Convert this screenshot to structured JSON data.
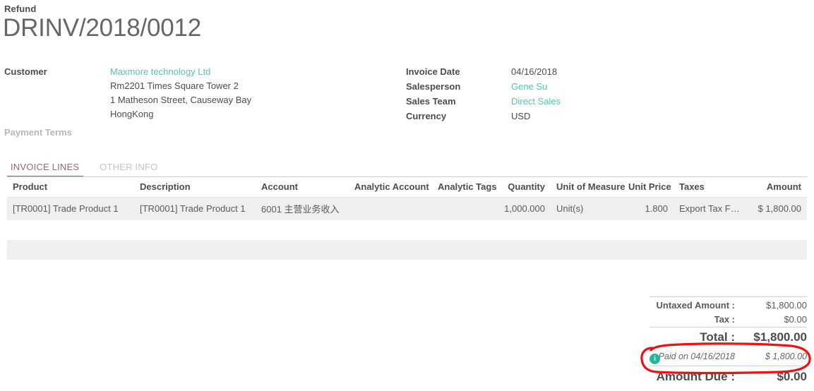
{
  "header": {
    "doc_type": "Refund",
    "title": "DRINV/2018/0012"
  },
  "fields_left": {
    "customer_label": "Customer",
    "customer_name": "Maxmore technology Ltd",
    "address_line1": "Rm2201 Times Square Tower 2",
    "address_line2": "1 Matheson Street, Causeway Bay",
    "address_line3": "HongKong",
    "payment_terms_label": "Payment Terms",
    "payment_terms_value": ""
  },
  "fields_right": {
    "invoice_date_label": "Invoice Date",
    "invoice_date_value": "04/16/2018",
    "salesperson_label": "Salesperson",
    "salesperson_value": "Gene Su",
    "sales_team_label": "Sales Team",
    "sales_team_value": "Direct Sales",
    "currency_label": "Currency",
    "currency_value": "USD"
  },
  "tabs": [
    {
      "label": "INVOICE LINES",
      "active": true
    },
    {
      "label": "OTHER INFO",
      "active": false
    }
  ],
  "lines_table": {
    "columns": [
      "Product",
      "Description",
      "Account",
      "Analytic Account",
      "Analytic Tags",
      "Quantity",
      "Unit of Measure",
      "Unit Price",
      "Taxes",
      "Amount"
    ],
    "rows": [
      {
        "product": "[TR0001] Trade Product 1",
        "description": "[TR0001] Trade Product 1",
        "account": "6001 主营业务收入",
        "analytic_account": "",
        "analytic_tags": "",
        "quantity": "1,000.000",
        "unit_of_measure": "Unit(s)",
        "unit_price": "1.800",
        "taxes": "Export Tax Free",
        "amount": "$ 1,800.00"
      }
    ]
  },
  "totals": {
    "untaxed_label": "Untaxed Amount :",
    "untaxed_value": "$1,800.00",
    "tax_label": "Tax :",
    "tax_value": "$0.00",
    "total_label": "Total :",
    "total_value": "$1,800.00",
    "paid_label": "Paid on 04/16/2018",
    "paid_value": "$ 1,800.00",
    "paid_icon": "info-icon",
    "amount_due_label": "Amount Due :",
    "amount_due_value": "$0.00"
  },
  "annotation": {
    "shape": "hand-drawn-ellipse",
    "color": "#ee1111",
    "target": "paid-row"
  },
  "colors": {
    "link_teal": "#51c7b5",
    "tab_active": "#8f6b7d",
    "title_grey": "#666666",
    "row_grey": "#efefef",
    "info_badge": "#21b799",
    "annotation_red": "#ee1111"
  }
}
